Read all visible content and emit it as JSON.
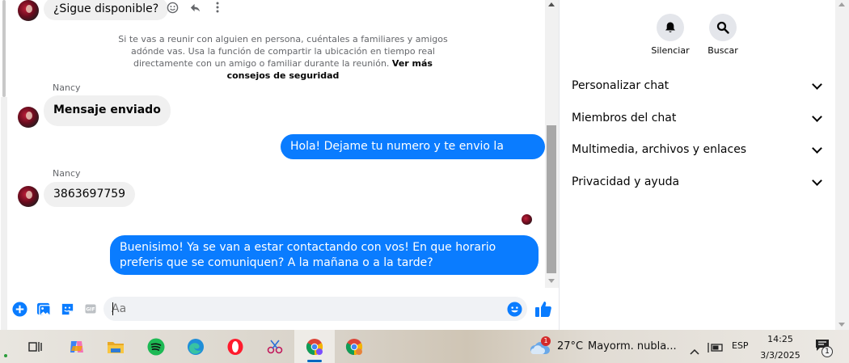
{
  "conversation": {
    "top_message": "¿Sigue disponible?",
    "safety_notice": "Si te vas a reunir con alguien en persona, cuéntales a familiares y amigos adónde vas. Usa la función de compartir la ubicación en tiempo real directamente con un amigo o familiar durante la reunión.",
    "safety_link": "Ver más consejos de seguridad",
    "sender_1": "Nancy",
    "msg_in_1": "Mensaje enviado",
    "msg_out_1": "Hola! Dejame tu numero y te envio la información",
    "sender_2": "Nancy",
    "msg_in_2": "3863697759",
    "msg_out_2": "Buenisimo! Ya se van a estar contactando con vos! En que horario preferis que se comuniquen? A la mañana o a la tarde?"
  },
  "composer": {
    "placeholder": "Aa"
  },
  "right_panel": {
    "mute_label": "Silenciar",
    "search_label": "Buscar",
    "sections": [
      {
        "label": "Personalizar chat"
      },
      {
        "label": "Miembros del chat"
      },
      {
        "label": "Multimedia, archivos y enlaces"
      },
      {
        "label": "Privacidad y ayuda"
      }
    ]
  },
  "taskbar": {
    "weather_badge": "1",
    "temperature": "27°C",
    "weather_desc": "Mayorm. nubla...",
    "language": "ESP",
    "time": "14:25",
    "date": "3/3/2025",
    "notification_count": "1"
  },
  "colors": {
    "accent": "#0a7cff",
    "bubble_in": "#f0f0f0"
  }
}
